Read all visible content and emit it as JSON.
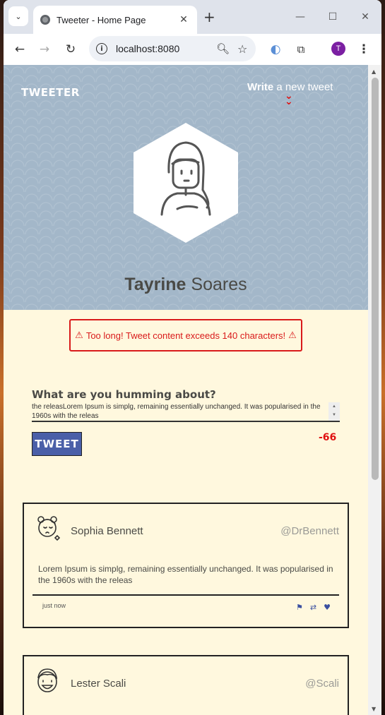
{
  "browser": {
    "tab_title": "Tweeter - Home Page",
    "url": "localhost:8080",
    "profile_initial": "T"
  },
  "header": {
    "logo": "TWEETER",
    "write_bold": "Write",
    "write_rest": " a new tweet",
    "user_first": "Tayrine",
    "user_last": " Soares"
  },
  "error": {
    "message": "Too long! Tweet content exceeds 140 characters!"
  },
  "compose": {
    "label": "What are you humming about?",
    "value": "the releasLorem Ipsum is simplg, remaining essentially unchanged. It was popularised in the 1960s with the releas",
    "button": "TWEET",
    "counter": "-66"
  },
  "tweets": [
    {
      "name": "Sophia Bennett",
      "handle": "@DrBennett",
      "content": "Lorem Ipsum is simplg, remaining essentially unchanged. It was popularised in the 1960s with the releas",
      "time": "just now"
    },
    {
      "name": "Lester Scali",
      "handle": "@Scali"
    }
  ],
  "colors": {
    "header_bg": "#a3b7c9",
    "page_bg": "#fff8de",
    "error_red": "#d91a1a",
    "button_blue": "#4a5fa8"
  }
}
